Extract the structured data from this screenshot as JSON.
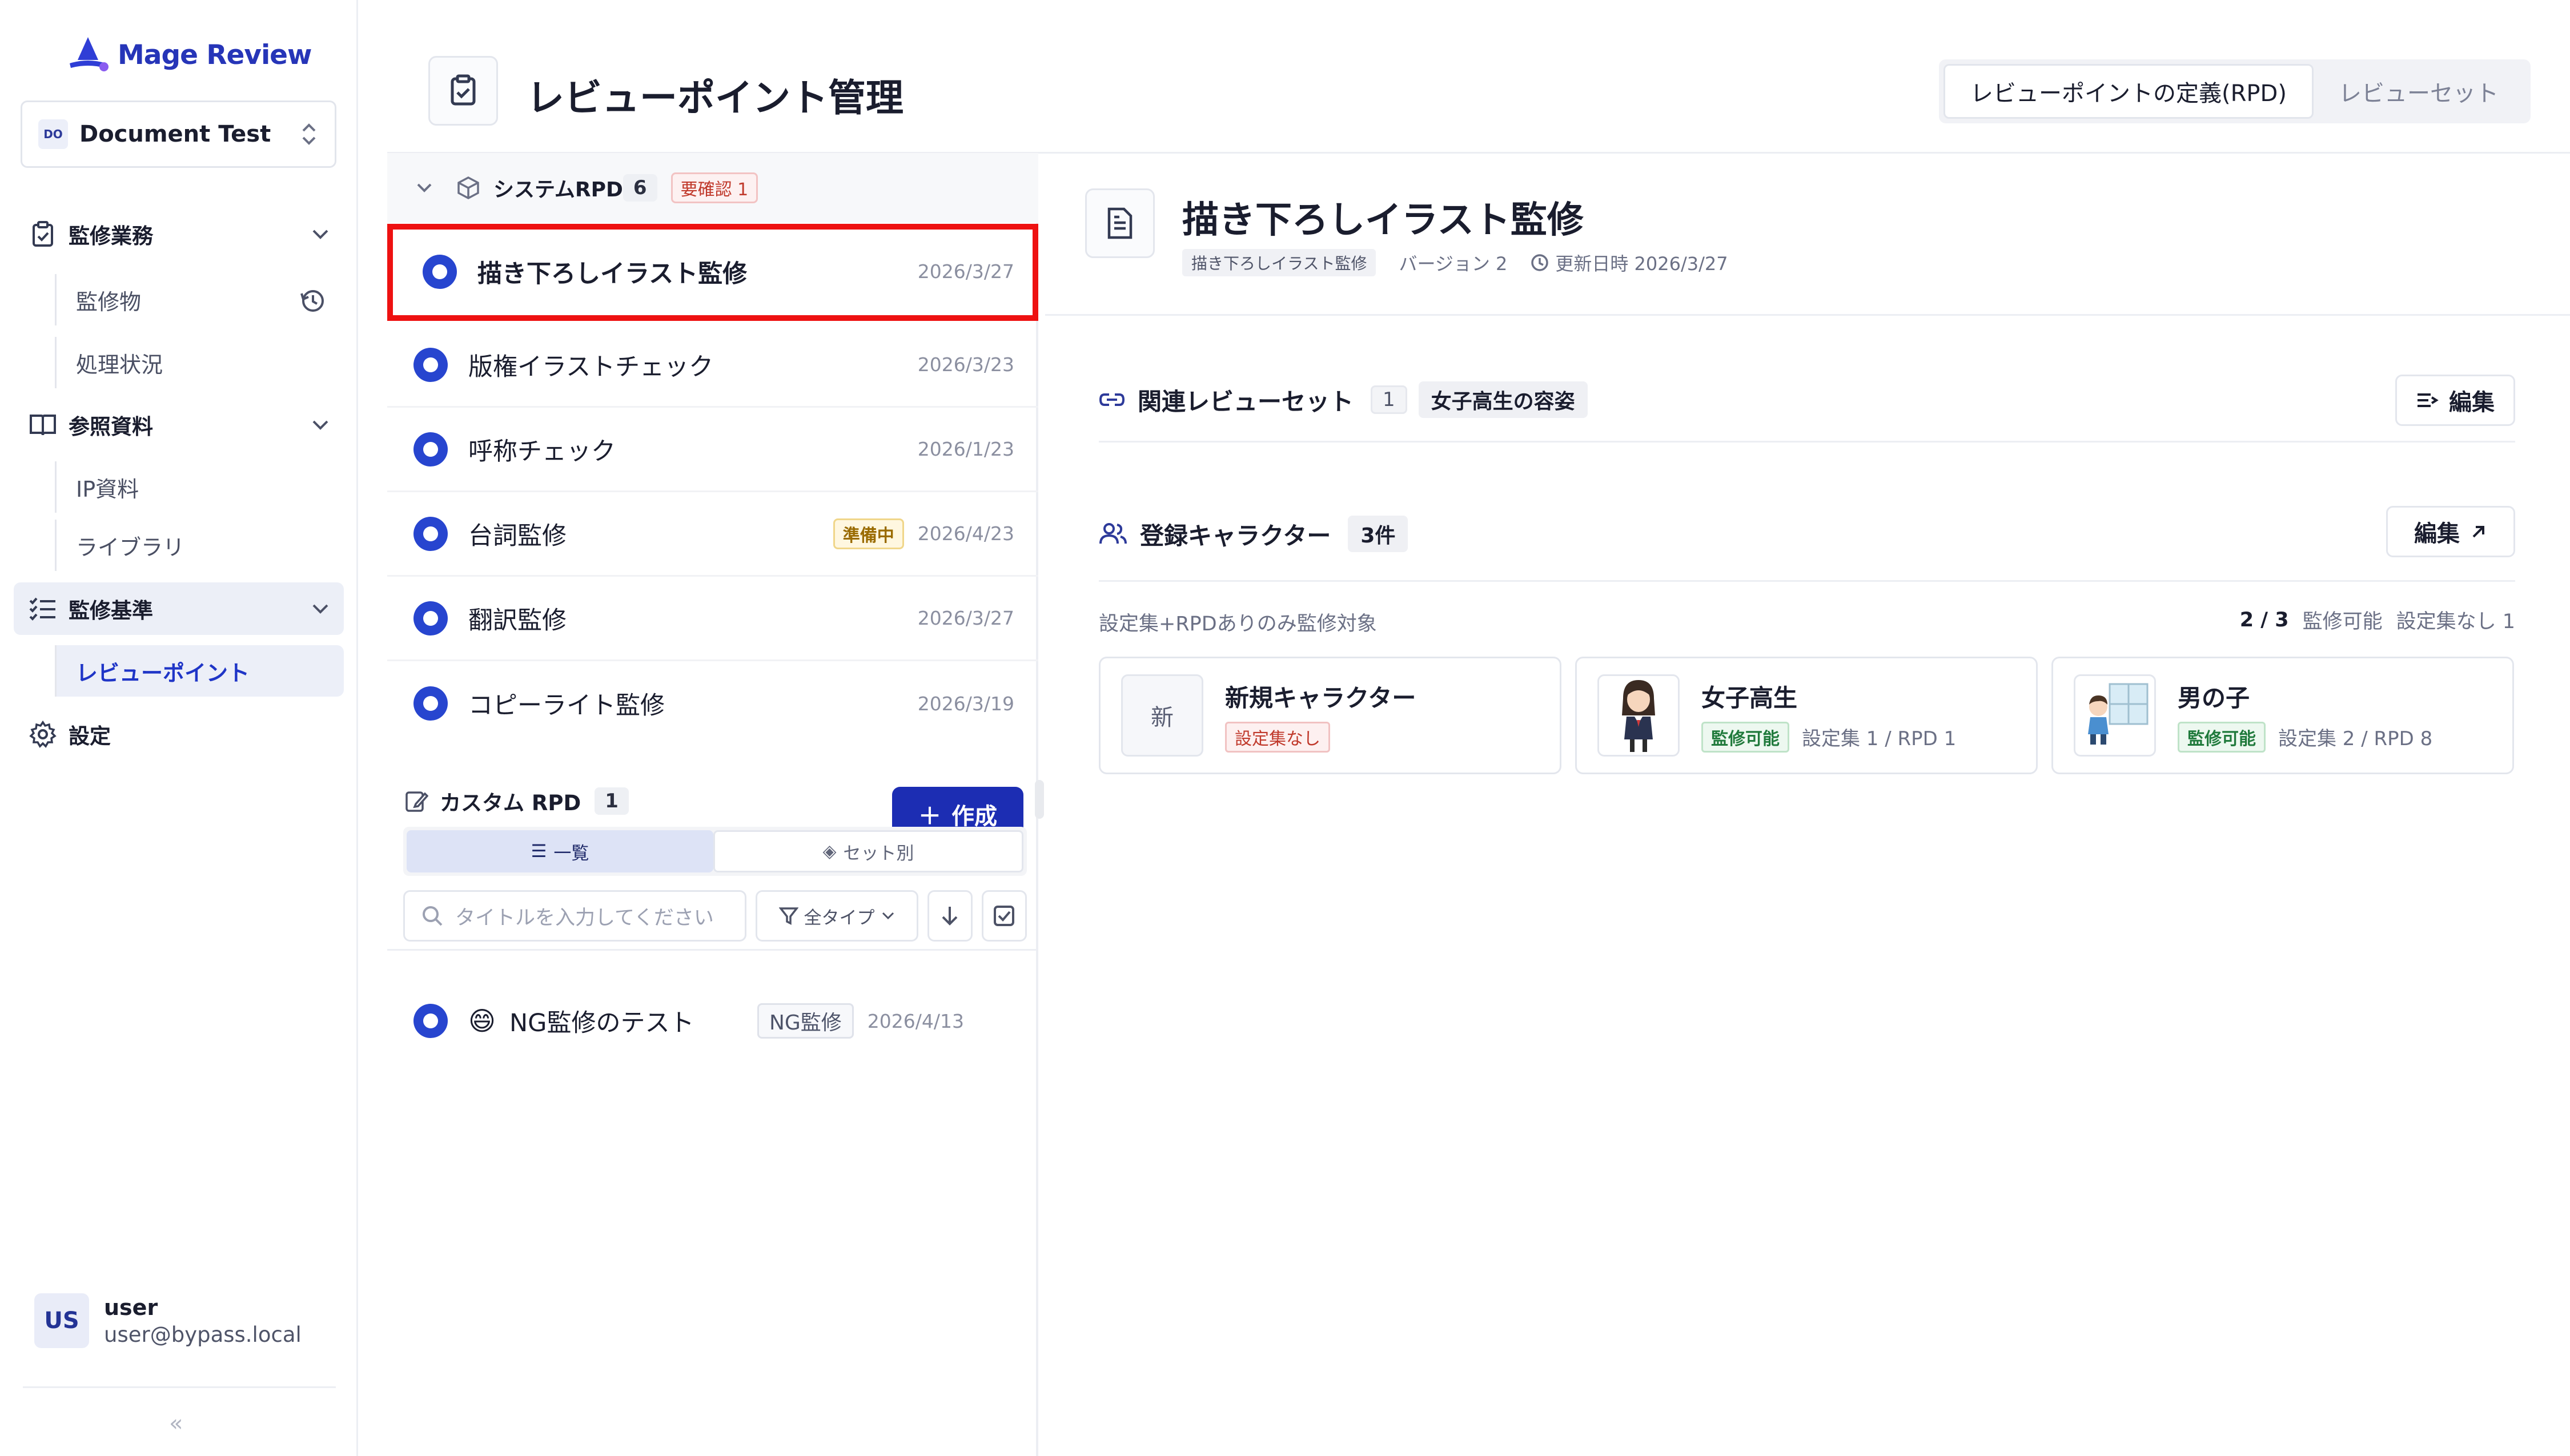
{
  "sidebar": {
    "brand": "Mage Review",
    "workspace": {
      "badge": "DO",
      "name": "Document Test"
    },
    "groups": [
      {
        "label": "監修業務",
        "items": [
          "監修物",
          "処理状況"
        ]
      },
      {
        "label": "参照資料",
        "items": [
          "IP資料",
          "ライブラリ"
        ]
      },
      {
        "label": "監修基準",
        "items": [
          "レビューポイント"
        ]
      },
      {
        "label": "設定"
      }
    ],
    "user": {
      "avatar": "US",
      "name": "user",
      "email": "user@bypass.local"
    },
    "collapse": "«"
  },
  "header": {
    "title": "レビューポイント管理",
    "tabs": [
      "レビューポイントの定義(RPD)",
      "レビューセット"
    ]
  },
  "list": {
    "system": {
      "title": "システムRPD",
      "count": "6",
      "badge": "要確認 1"
    },
    "rows": [
      {
        "title": "描き下ろしイラスト監修",
        "date": "2026/3/27"
      },
      {
        "title": "版権イラストチェック",
        "date": "2026/3/23"
      },
      {
        "title": "呼称チェック",
        "date": "2026/1/23"
      },
      {
        "title": "台詞監修",
        "date": "2026/4/23",
        "tag": "準備中"
      },
      {
        "title": "翻訳監修",
        "date": "2026/3/27"
      },
      {
        "title": "コピーライト監修",
        "date": "2026/3/19"
      }
    ],
    "custom": {
      "title": "カスタム RPD",
      "count": "1",
      "create": "作成"
    },
    "segments": [
      "一覧",
      "セット別"
    ],
    "search_placeholder": "タイトルを入力してください",
    "filter": "全タイプ",
    "custom_rows": [
      {
        "emoji": "😄",
        "title": "NG監修のテスト",
        "tag": "NG監修",
        "date": "2026/4/13"
      }
    ]
  },
  "detail": {
    "title": "描き下ろしイラスト監修",
    "chip": "描き下ろしイラスト監修",
    "version": "バージョン  2",
    "updated": "更新日時 2026/3/27",
    "related": {
      "title": "関連レビューセット",
      "count": "1",
      "tag": "女子高生の容姿",
      "edit": "編集"
    },
    "characters": {
      "title": "登録キャラクター",
      "count": "3件",
      "edit": "編集",
      "note": "設定集+RPDありのみ監修対象",
      "ratio": "2  /  3",
      "ratio_label": "監修可能",
      "ratio_none": "設定集なし 1",
      "cards": [
        {
          "thumb": "新",
          "name": "新規キャラクター",
          "status": "設定集なし",
          "detail": ""
        },
        {
          "name": "女子高生",
          "status": "監修可能",
          "detail": "設定集 1 / RPD 1"
        },
        {
          "name": "男の子",
          "status": "監修可能",
          "detail": "設定集 2 / RPD 8"
        }
      ]
    }
  },
  "colors": {
    "accent": "#1c2db3",
    "radio": "#2745cf",
    "highlight": "#ee1111",
    "brand": "#2635b8"
  }
}
